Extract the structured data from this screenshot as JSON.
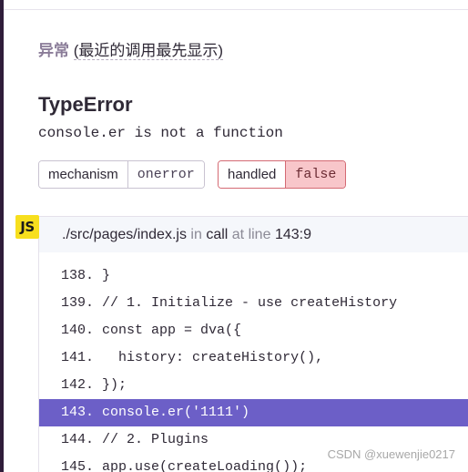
{
  "exception": {
    "section_label": "异常",
    "section_sub": "(最近的调用最先显示)",
    "type": "TypeError",
    "value": "console.er is not a function"
  },
  "tags": [
    {
      "key": "mechanism",
      "value": "onerror"
    },
    {
      "key": "handled",
      "value": "false"
    }
  ],
  "frame": {
    "badge": "JS",
    "filename": "./src/pages/index.js",
    "in_word": "in",
    "function": "call",
    "at_line_word": "at line",
    "location": "143:9"
  },
  "code": {
    "lines": [
      {
        "num": "138.",
        "text": "}"
      },
      {
        "num": "139.",
        "text": "// 1. Initialize - use createHistory"
      },
      {
        "num": "140.",
        "text": "const app = dva({"
      },
      {
        "num": "141.",
        "text": "  history: createHistory(),"
      },
      {
        "num": "142.",
        "text": "});"
      },
      {
        "num": "143.",
        "text": "console.er('1111')"
      },
      {
        "num": "144.",
        "text": "// 2. Plugins"
      },
      {
        "num": "145.",
        "text": "app.use(createLoading());"
      }
    ],
    "active_line": "143."
  },
  "watermark": "CSDN @xuewenjie0217",
  "colors": {
    "accent": "#6c5fc7",
    "handled_false_bg": "#f8c6ca",
    "js_badge": "#f7df1e"
  }
}
